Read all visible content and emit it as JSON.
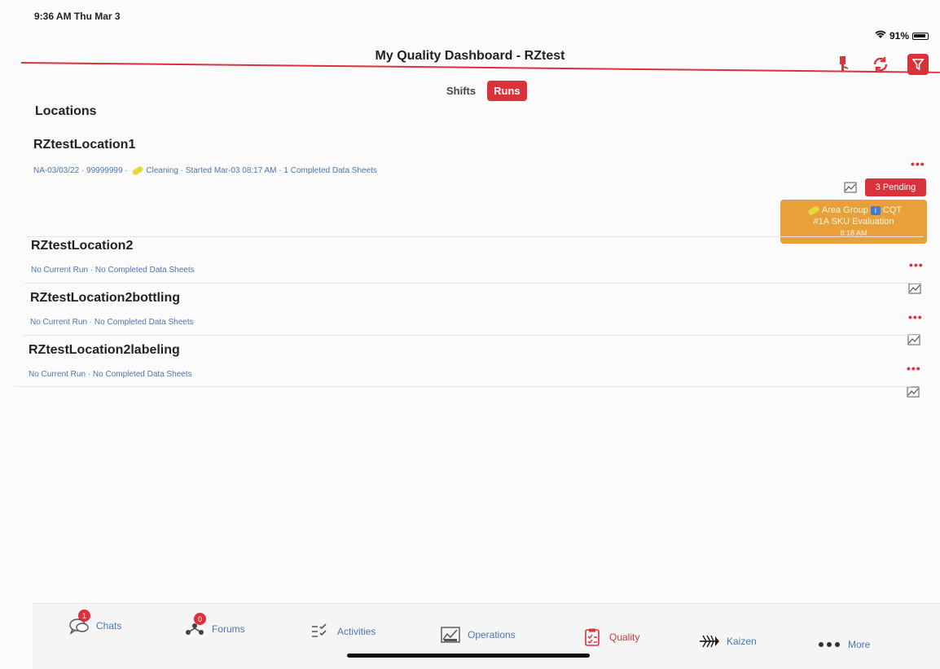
{
  "status": {
    "time": "9:36 AM  Thu Mar 3",
    "battery": "91%"
  },
  "header": {
    "title": "My Quality Dashboard - RZtest"
  },
  "segments": {
    "shifts": "Shifts",
    "runs": "Runs"
  },
  "section": {
    "title": "Locations"
  },
  "locations": [
    {
      "name": "RZtestLocation1",
      "meta_prefix": "NA-03/03/22 · 99999999 · ",
      "meta_cleaning": "Cleaning",
      "meta_suffix": " · Started Mar-03 08:17 AM · 1 Completed Data Sheets"
    },
    {
      "name": "RZtestLocation2",
      "meta": "No Current Run · No Completed Data Sheets"
    },
    {
      "name": "RZtestLocation2bottling",
      "meta": "No Current Run · No Completed Data Sheets"
    },
    {
      "name": "RZtestLocation2labeling",
      "meta": "No Current Run · No Completed Data Sheets"
    }
  ],
  "pending": {
    "label": "3 Pending"
  },
  "area_card": {
    "line1_a": "Area Group",
    "line1_b": "CQT",
    "line2": "#1A SKU Evaluation",
    "time": "8:18 AM"
  },
  "tabs": [
    {
      "label": "Chats",
      "badge": "1",
      "icon": "chat-icon"
    },
    {
      "label": "Forums",
      "badge": "0",
      "icon": "forums-icon"
    },
    {
      "label": "Activities",
      "icon": "activities-icon"
    },
    {
      "label": "Operations",
      "icon": "operations-icon"
    },
    {
      "label": "Quality",
      "icon": "quality-icon"
    },
    {
      "label": "Kaizen",
      "icon": "kaizen-icon"
    },
    {
      "label": "More",
      "icon": "more-icon"
    }
  ],
  "colors": {
    "accent": "#d9323c",
    "link": "#4a76b5",
    "card": "#e8a13a"
  }
}
